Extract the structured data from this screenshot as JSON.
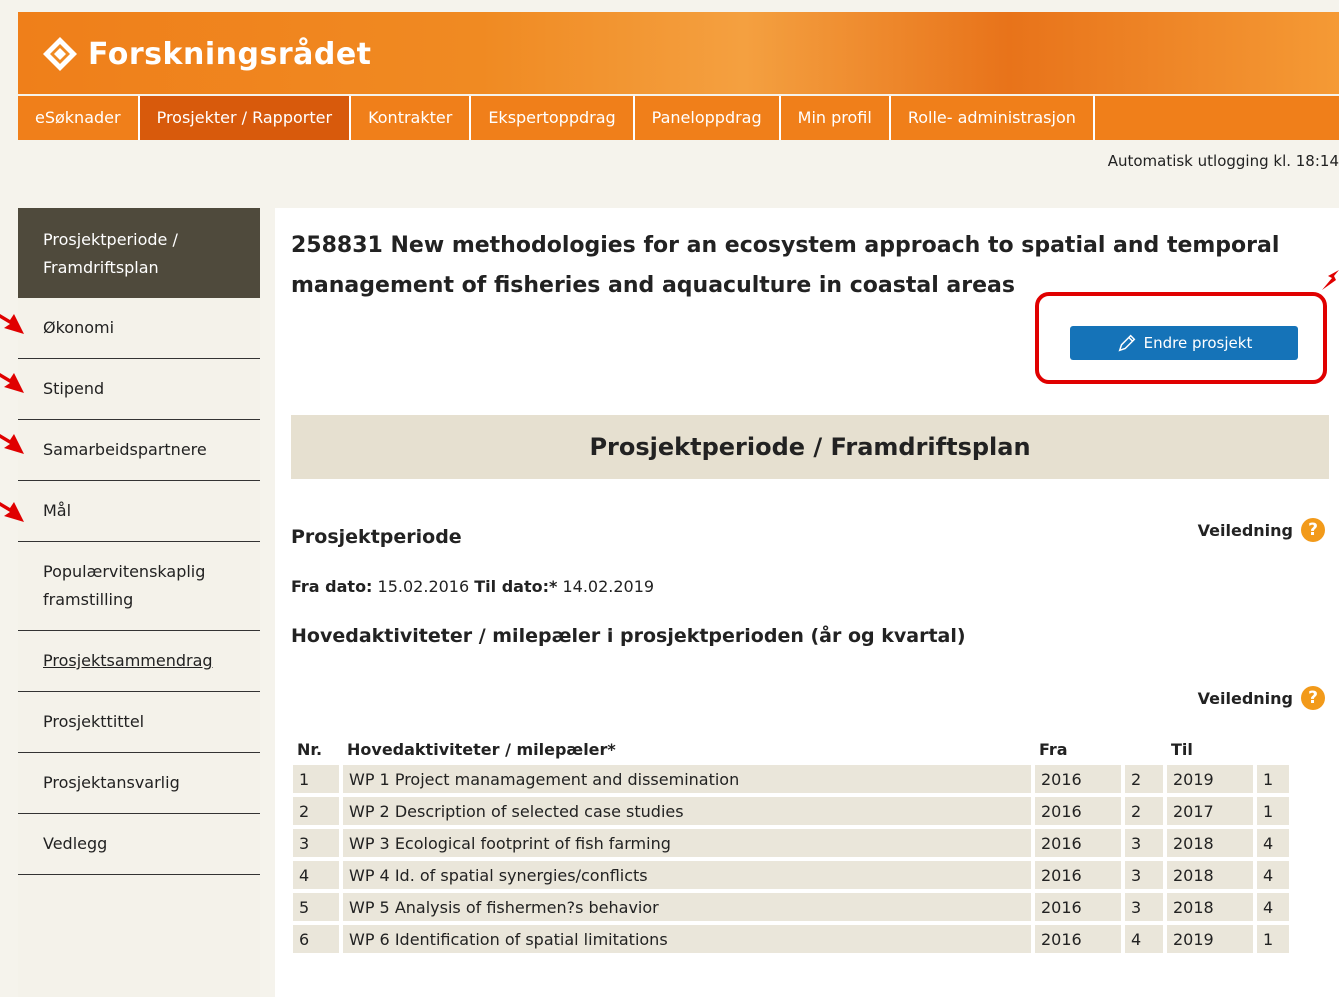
{
  "brand": {
    "name": "Forskningsrådet"
  },
  "nav": {
    "items": [
      "eSøknader",
      "Prosjekter / Rapporter",
      "Kontrakter",
      "Ekspertoppdrag",
      "Paneloppdrag",
      "Min profil",
      "Rolle- administrasjon"
    ],
    "active": "Prosjekter / Rapporter"
  },
  "logout_text": "Automatisk utlogging kl. 18:14",
  "sidebar": {
    "items": [
      "Prosjektperiode / Framdriftsplan",
      "Økonomi",
      "Stipend",
      "Samarbeidspartnere",
      "Mål",
      "Populærvitenskaplig framstilling",
      "Prosjektsammendrag",
      "Prosjekttittel",
      "Prosjektansvarlig",
      "Vedlegg"
    ]
  },
  "project": {
    "title": "258831  New methodologies for an ecosystem approach to spatial and temporal management of fisheries and aquaculture in coastal areas"
  },
  "edit_button": {
    "label": "Endre prosjekt"
  },
  "section": {
    "title": "Prosjektperiode / Framdriftsplan"
  },
  "guide": {
    "label": "Veiledning"
  },
  "period": {
    "heading": "Prosjektperiode",
    "from_label": "Fra dato:",
    "from_value": "15.02.2016",
    "to_label": "Til dato:*",
    "to_value": "14.02.2019"
  },
  "activities": {
    "heading": "Hovedaktiviteter / milepæler i prosjektperioden (år og kvartal)",
    "columns": {
      "nr": "Nr.",
      "activity": "Hovedaktiviteter / milepæler*",
      "from": "Fra",
      "to": "Til"
    },
    "rows": [
      [
        "1",
        "WP 1 Project manamagement and dissemination",
        "2016",
        "2",
        "2019",
        "1"
      ],
      [
        "2",
        "WP 2 Description of selected case studies",
        "2016",
        "2",
        "2017",
        "1"
      ],
      [
        "3",
        "WP 3 Ecological footprint of fish farming",
        "2016",
        "3",
        "2018",
        "4"
      ],
      [
        "4",
        "WP 4 Id. of spatial synergies/conflicts",
        "2016",
        "3",
        "2018",
        "4"
      ],
      [
        "5",
        "WP 5 Analysis of fishermen?s behavior",
        "2016",
        "3",
        "2018",
        "4"
      ],
      [
        "6",
        "WP 6 Identification of spatial limitations",
        "2016",
        "4",
        "2019",
        "1"
      ]
    ]
  },
  "colors": {
    "brand_orange": "#f07f1a",
    "active_nav": "#d85a0c",
    "button_blue": "#1573b8",
    "highlight_red": "#e00000"
  }
}
